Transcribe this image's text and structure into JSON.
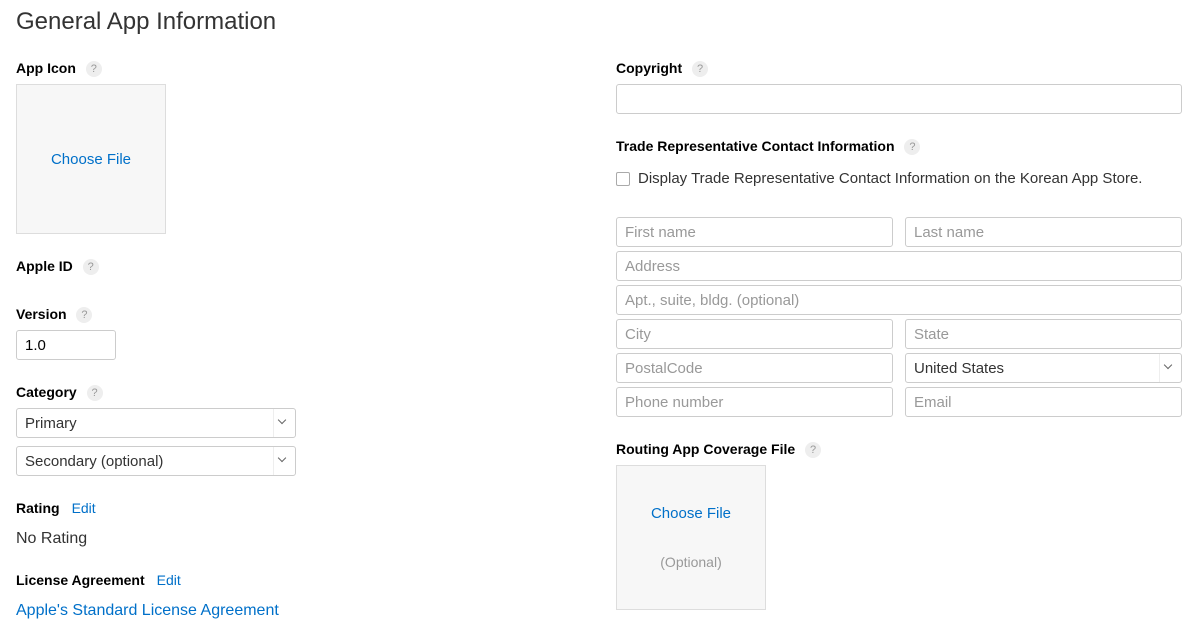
{
  "page_title": "General App Information",
  "left": {
    "app_icon": {
      "label": "App Icon",
      "choose_file": "Choose File"
    },
    "apple_id": {
      "label": "Apple ID"
    },
    "version": {
      "label": "Version",
      "value": "1.0"
    },
    "category": {
      "label": "Category",
      "primary": "Primary",
      "secondary": "Secondary (optional)"
    },
    "rating": {
      "label": "Rating",
      "edit": "Edit",
      "value": "No Rating"
    },
    "license": {
      "label": "License Agreement",
      "edit": "Edit",
      "value": "Apple's Standard License Agreement"
    }
  },
  "right": {
    "copyright": {
      "label": "Copyright"
    },
    "trade_rep": {
      "label": "Trade Representative Contact Information",
      "checkbox_label": "Display Trade Representative Contact Information on the Korean App Store.",
      "first_name": "First name",
      "last_name": "Last name",
      "address": "Address",
      "apt": "Apt., suite, bldg. (optional)",
      "city": "City",
      "state": "State",
      "postal": "PostalCode",
      "country": "United States",
      "phone": "Phone number",
      "email": "Email"
    },
    "routing": {
      "label": "Routing App Coverage File",
      "choose_file": "Choose File",
      "optional": "(Optional)"
    }
  },
  "help_glyph": "?"
}
